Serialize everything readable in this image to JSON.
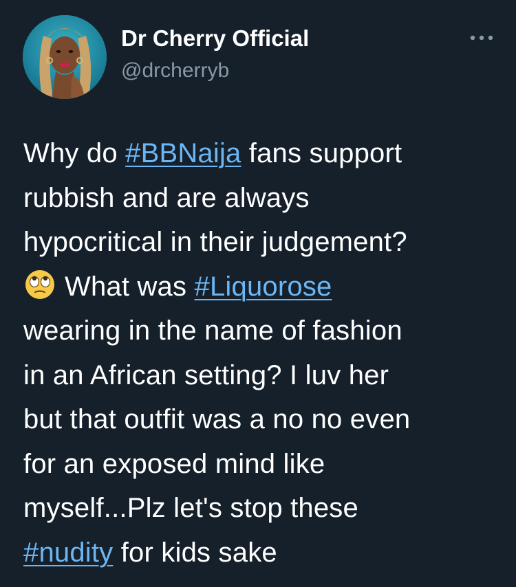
{
  "author": {
    "name": "Dr Cherry Official",
    "handle": "@drcherryb",
    "avatar_icon": "profile-photo"
  },
  "more_icon": "more-horizontal-icon",
  "tweet": {
    "lines": [
      {
        "parts": [
          {
            "t": "Why do "
          },
          {
            "tag": "#BBNaija"
          },
          {
            "t": " fans support"
          }
        ]
      },
      {
        "parts": [
          {
            "t": "rubbish and are always"
          }
        ]
      },
      {
        "parts": [
          {
            "t": "hypocritical in their judgement?"
          }
        ]
      },
      {
        "parts": [
          {
            "emoji": "face-with-rolling-eyes"
          },
          {
            "t": "What was "
          },
          {
            "tag": "#Liquorose"
          }
        ]
      },
      {
        "parts": [
          {
            "t": "wearing in the name of fashion"
          }
        ]
      },
      {
        "parts": [
          {
            "t": "in an African setting? I luv her"
          }
        ]
      },
      {
        "parts": [
          {
            "t": "but that outfit was a no no even"
          }
        ]
      },
      {
        "parts": [
          {
            "t": "for an exposed mind like"
          }
        ]
      },
      {
        "parts": [
          {
            "t": "myself...Plz let's stop these"
          }
        ]
      },
      {
        "parts": [
          {
            "tag": "#nudity"
          },
          {
            "t": " for kids sake"
          }
        ]
      }
    ]
  },
  "colors": {
    "background": "#15202b",
    "text": "#ffffff",
    "secondary_text": "#8b98a5",
    "link": "#6cb6f3"
  }
}
